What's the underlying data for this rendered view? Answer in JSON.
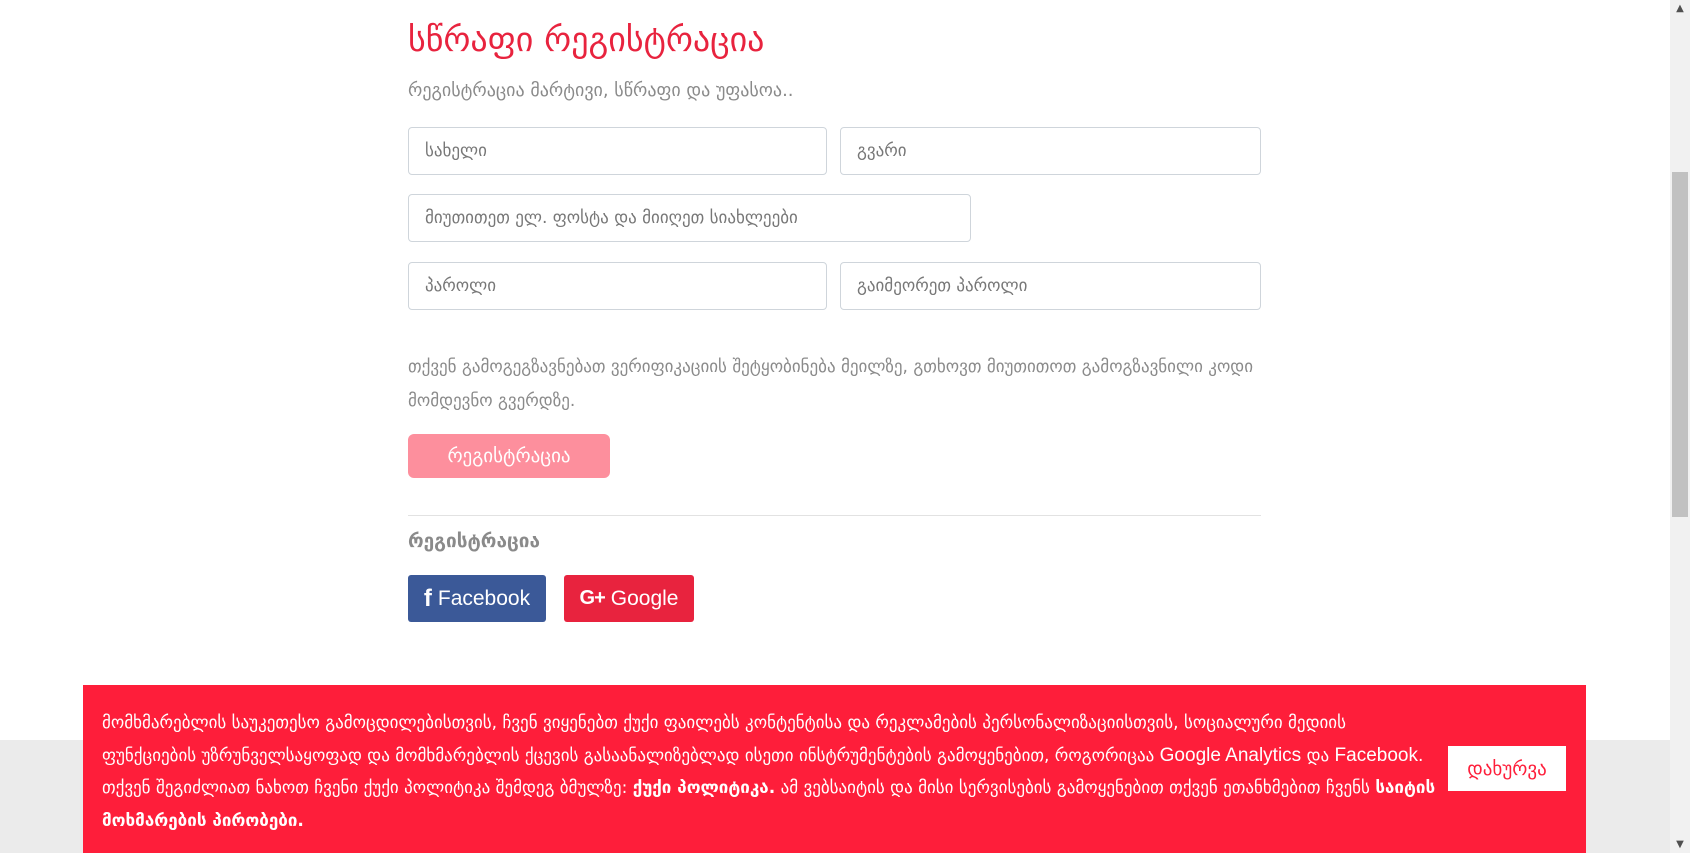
{
  "form": {
    "title": "სწრაფი რეგისტრაცია",
    "subtitle": "რეგისტრაცია მარტივი, სწრაფი და უფასოა..",
    "fields": {
      "first_name_placeholder": "სახელი",
      "last_name_placeholder": "გვარი",
      "email_placeholder": "მიუთითეთ ელ. ფოსტა და მიიღეთ სიახლეები",
      "password_placeholder": "პაროლი",
      "repeat_password_placeholder": "გაიმეორეთ პაროლი"
    },
    "verification_note": "თქვენ გამოგეგზავნებათ ვერიფიკაციის შეტყობინება მეილზე, გთხოვთ მიუთითოთ გამოგზავნილი კოდი მომდევნო გვერდზე.",
    "submit_label": "რეგისტრაცია"
  },
  "social": {
    "heading": "რეგისტრაცია",
    "facebook_label": "Facebook",
    "facebook_icon": "facebook-f-icon",
    "google_label": "Google",
    "google_icon": "google-plus-icon",
    "facebook_color": "#3b5998",
    "google_color": "#e8233e"
  },
  "cookie": {
    "text_1": "მომხმარებლის საუკეთესო გამოცდილებისთვის, ჩვენ ვიყენებთ ქუქი ფაილებს კონტენტისა და რეკლამების პერსონალიზაციისთვის, სოციალური მედიის ფუნქციების უზრუნველსაყოფად და მომხმარებლის ქცევის გასაანალიზებლად ისეთი ინსტრუმენტების გამოყენებით, როგორიცაა",
    "google_analytics": "Google Analytics",
    "and": "და",
    "facebook": "Facebook",
    "text_2": ". თქვენ შეგიძლიათ ნახოთ ჩვენი ქუქი პოლიტიკა შემდეგ ბმულზე:",
    "policy_link": "ქუქი პოლიტიკა.",
    "text_3": "ამ ვებსაიტის და მისი სერვისების გამოყენებით თქვენ ეთანხმებით ჩვენს",
    "terms_link": "საიტის მოხმარების პირობები.",
    "close_label": "დახურვა",
    "bar_color": "#fe1e3a"
  },
  "colors": {
    "accent": "#e8233e",
    "submit_disabled": "#fd8f9d"
  }
}
